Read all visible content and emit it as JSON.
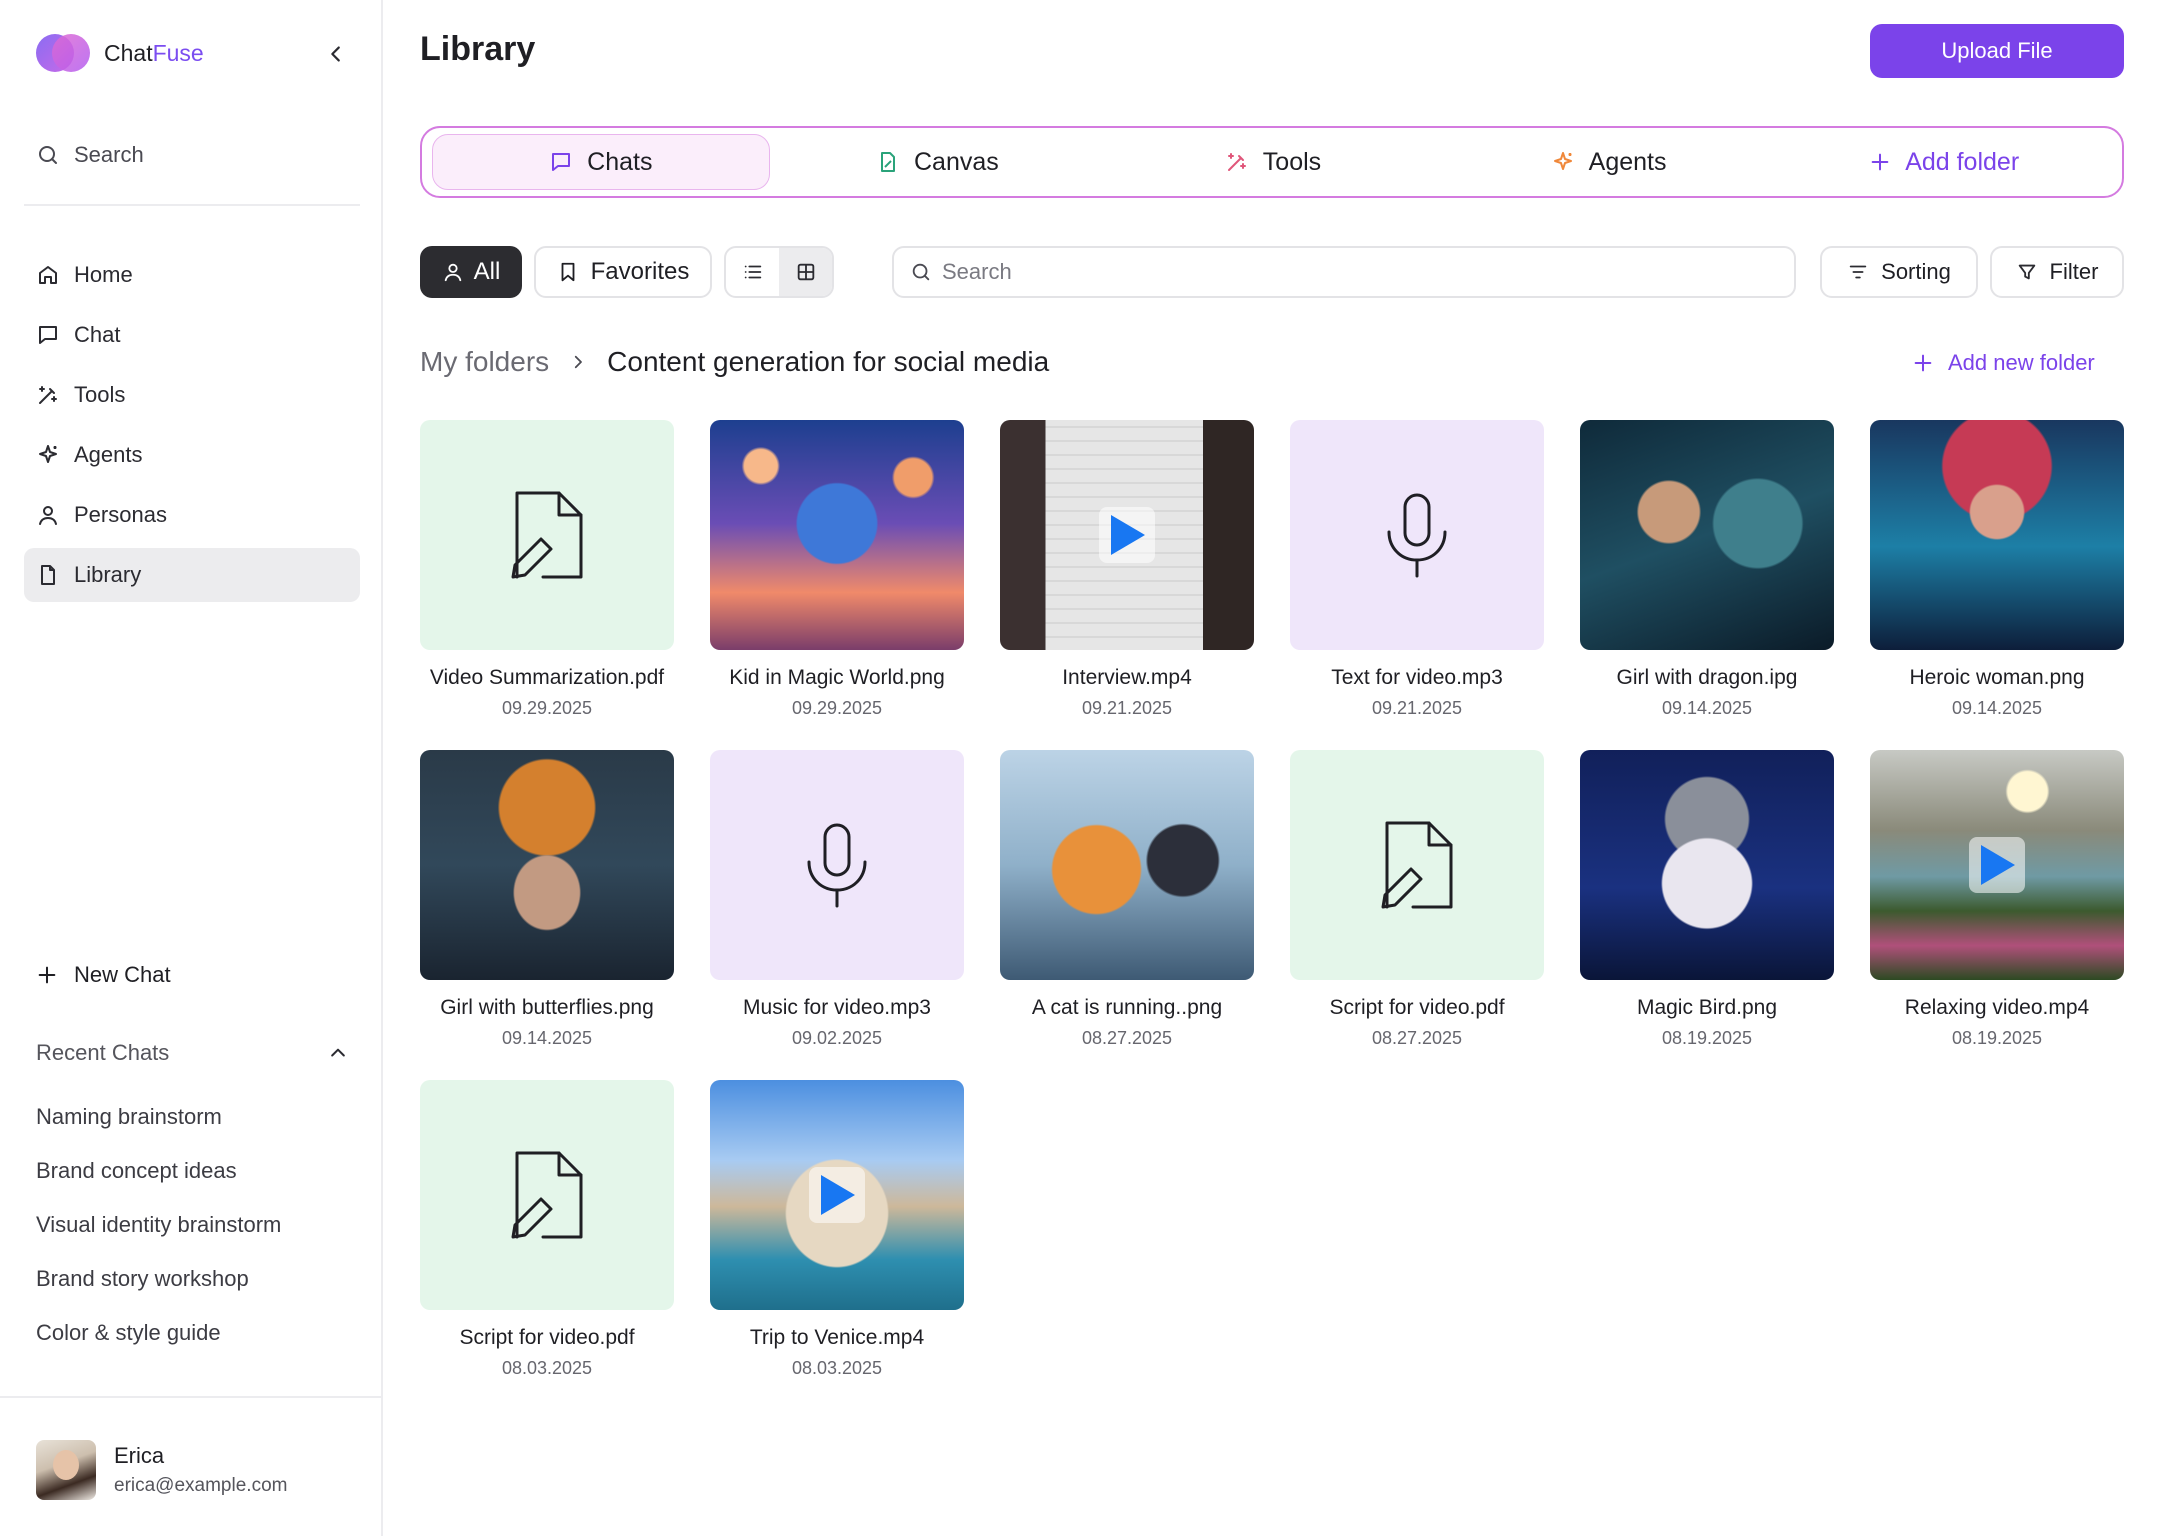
{
  "app": {
    "name_part1": "Chat",
    "name_part2": "Fuse"
  },
  "sidebar": {
    "search_label": "Search",
    "nav": [
      {
        "label": "Home",
        "icon": "home-icon"
      },
      {
        "label": "Chat",
        "icon": "chat-bubble-icon"
      },
      {
        "label": "Tools",
        "icon": "magic-wand-icon"
      },
      {
        "label": "Agents",
        "icon": "sparkle-icon"
      },
      {
        "label": "Personas",
        "icon": "person-icon"
      },
      {
        "label": "Library",
        "icon": "file-icon",
        "active": true
      }
    ],
    "new_chat_label": "New Chat",
    "recent_title": "Recent Chats",
    "recent": [
      "Naming brainstorm",
      "Brand concept ideas",
      "Visual identity brainstorm",
      "Brand story workshop",
      "Color & style guide"
    ],
    "user": {
      "name": "Erica",
      "email": "erica@example.com"
    }
  },
  "header": {
    "title": "Library",
    "upload_label": "Upload File"
  },
  "tabs": [
    {
      "label": "Chats",
      "icon": "chat-bubble-icon",
      "active": true
    },
    {
      "label": "Canvas",
      "icon": "canvas-icon"
    },
    {
      "label": "Tools",
      "icon": "magic-wand-icon"
    },
    {
      "label": "Agents",
      "icon": "sparkle-icon"
    },
    {
      "label": "Add folder",
      "icon": "plus-icon"
    }
  ],
  "filters": {
    "all_label": "All",
    "favorites_label": "Favorites",
    "view_mode": "grid",
    "search_placeholder": "Search",
    "sorting_label": "Sorting",
    "filter_label": "Filter"
  },
  "breadcrumb": {
    "root": "My folders",
    "current": "Content generation for social media"
  },
  "add_new_folder_label": "Add new folder",
  "colors": {
    "accent": "#7b43ea",
    "doc_bg": "#e4f6ea",
    "audio_bg": "#efe6fa",
    "play_blue": "#1877f2"
  },
  "files": [
    {
      "name": "Video Summarization.pdf",
      "date": "09.29.2025",
      "kind": "doc"
    },
    {
      "name": "Kid in Magic World.png",
      "date": "09.29.2025",
      "kind": "image"
    },
    {
      "name": "Interview.mp4",
      "date": "09.21.2025",
      "kind": "video"
    },
    {
      "name": "Text for video.mp3",
      "date": "09.21.2025",
      "kind": "audio"
    },
    {
      "name": "Girl with dragon.ipg",
      "date": "09.14.2025",
      "kind": "image"
    },
    {
      "name": "Heroic woman.png",
      "date": "09.14.2025",
      "kind": "image"
    },
    {
      "name": "Girl with butterflies.png",
      "date": "09.14.2025",
      "kind": "image"
    },
    {
      "name": "Music for video.mp3",
      "date": "09.02.2025",
      "kind": "audio"
    },
    {
      "name": "A cat is running..png",
      "date": "08.27.2025",
      "kind": "image"
    },
    {
      "name": "Script for video.pdf",
      "date": "08.27.2025",
      "kind": "doc"
    },
    {
      "name": "Magic Bird.png",
      "date": "08.19.2025",
      "kind": "image"
    },
    {
      "name": "Relaxing video.mp4",
      "date": "08.19.2025",
      "kind": "video"
    },
    {
      "name": "Script for video.pdf",
      "date": "08.03.2025",
      "kind": "doc"
    },
    {
      "name": "Trip to Venice.mp4",
      "date": "08.03.2025",
      "kind": "video"
    }
  ]
}
